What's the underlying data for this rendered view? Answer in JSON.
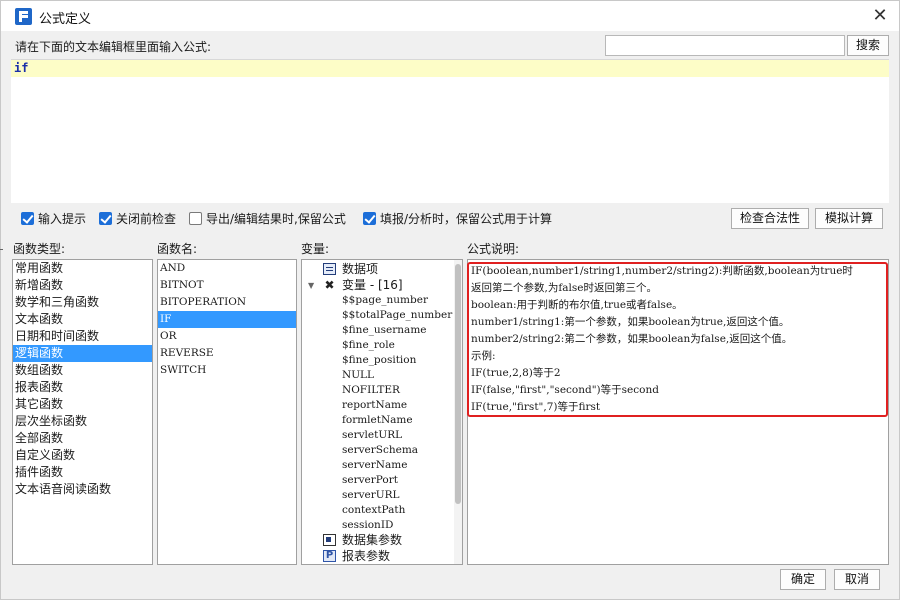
{
  "window": {
    "title": "公式定义",
    "close_label": "✕"
  },
  "search": {
    "placeholder": "",
    "value": "",
    "button_label": "搜索"
  },
  "editor": {
    "label": "请在下面的文本编辑框里面输入公式:",
    "content": "if"
  },
  "options": [
    {
      "label": "输入提示",
      "checked": true
    },
    {
      "label": "关闭前检查",
      "checked": true
    },
    {
      "label": "导出/编辑结果时,保留公式",
      "checked": false
    },
    {
      "label": "填报/分析时，保留公式用于计算",
      "checked": true
    }
  ],
  "actions": {
    "check_label": "检查合法性",
    "simulate_label": "模拟计算"
  },
  "sections": {
    "types": "函数类型:",
    "functions": "函数名:",
    "variables": "变量:",
    "description": "公式说明:"
  },
  "function_types": [
    "常用函数",
    "新增函数",
    "数学和三角函数",
    "文本函数",
    "日期和时间函数",
    "逻辑函数",
    "数组函数",
    "报表函数",
    "其它函数",
    "层次坐标函数",
    "全部函数",
    "自定义函数",
    "插件函数",
    "文本语音阅读函数"
  ],
  "selected_type": "逻辑函数",
  "function_names": [
    "AND",
    "BITNOT",
    "BITOPERATION",
    "IF",
    "OR",
    "REVERSE",
    "SWITCH"
  ],
  "selected_function": "IF",
  "variables_tree": {
    "data_items": "数据项",
    "variables": "变量 - [16]",
    "children": [
      "$$page_number",
      "$$totalPage_number",
      "$fine_username",
      "$fine_role",
      "$fine_position",
      "NULL",
      "NOFILTER",
      "reportName",
      "formletName",
      "servletURL",
      "serverSchema",
      "serverName",
      "serverPort",
      "serverURL",
      "contextPath",
      "sessionID"
    ],
    "dataset_params": "数据集参数",
    "report_params": "报表参数",
    "report_params_icon": "P"
  },
  "description": {
    "lines": [
      "IF(boolean,number1/string1,number2/string2):判断函数,boolean为true时",
      "返回第二个参数,为false时返回第三个。",
      "boolean:用于判断的布尔值,true或者false。",
      "number1/string1:第一个参数，如果boolean为true,返回这个值。",
      "number2/string2:第二个参数，如果boolean为false,返回这个值。",
      "示例:",
      "IF(true,2,8)等于2",
      "IF(false,\"first\",\"second\")等于second",
      "IF(true,\"first\",7)等于first"
    ],
    "highlight_color": "#e02020"
  },
  "footer": {
    "ok_label": "确定",
    "cancel_label": "取消"
  },
  "colors": {
    "selection": "#3399ff",
    "editor_line": "#fdfdc7",
    "keyword": "#1a2fa8"
  }
}
